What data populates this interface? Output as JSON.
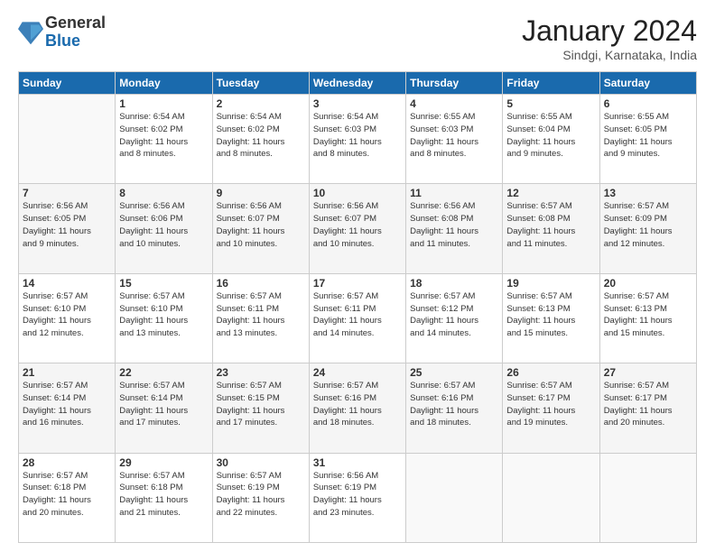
{
  "logo": {
    "general": "General",
    "blue": "Blue"
  },
  "title": "January 2024",
  "subtitle": "Sindgi, Karnataka, India",
  "days_header": [
    "Sunday",
    "Monday",
    "Tuesday",
    "Wednesday",
    "Thursday",
    "Friday",
    "Saturday"
  ],
  "weeks": [
    [
      {
        "day": "",
        "info": ""
      },
      {
        "day": "1",
        "info": "Sunrise: 6:54 AM\nSunset: 6:02 PM\nDaylight: 11 hours\nand 8 minutes."
      },
      {
        "day": "2",
        "info": "Sunrise: 6:54 AM\nSunset: 6:02 PM\nDaylight: 11 hours\nand 8 minutes."
      },
      {
        "day": "3",
        "info": "Sunrise: 6:54 AM\nSunset: 6:03 PM\nDaylight: 11 hours\nand 8 minutes."
      },
      {
        "day": "4",
        "info": "Sunrise: 6:55 AM\nSunset: 6:03 PM\nDaylight: 11 hours\nand 8 minutes."
      },
      {
        "day": "5",
        "info": "Sunrise: 6:55 AM\nSunset: 6:04 PM\nDaylight: 11 hours\nand 9 minutes."
      },
      {
        "day": "6",
        "info": "Sunrise: 6:55 AM\nSunset: 6:05 PM\nDaylight: 11 hours\nand 9 minutes."
      }
    ],
    [
      {
        "day": "7",
        "info": "Sunrise: 6:56 AM\nSunset: 6:05 PM\nDaylight: 11 hours\nand 9 minutes."
      },
      {
        "day": "8",
        "info": "Sunrise: 6:56 AM\nSunset: 6:06 PM\nDaylight: 11 hours\nand 10 minutes."
      },
      {
        "day": "9",
        "info": "Sunrise: 6:56 AM\nSunset: 6:07 PM\nDaylight: 11 hours\nand 10 minutes."
      },
      {
        "day": "10",
        "info": "Sunrise: 6:56 AM\nSunset: 6:07 PM\nDaylight: 11 hours\nand 10 minutes."
      },
      {
        "day": "11",
        "info": "Sunrise: 6:56 AM\nSunset: 6:08 PM\nDaylight: 11 hours\nand 11 minutes."
      },
      {
        "day": "12",
        "info": "Sunrise: 6:57 AM\nSunset: 6:08 PM\nDaylight: 11 hours\nand 11 minutes."
      },
      {
        "day": "13",
        "info": "Sunrise: 6:57 AM\nSunset: 6:09 PM\nDaylight: 11 hours\nand 12 minutes."
      }
    ],
    [
      {
        "day": "14",
        "info": "Sunrise: 6:57 AM\nSunset: 6:10 PM\nDaylight: 11 hours\nand 12 minutes."
      },
      {
        "day": "15",
        "info": "Sunrise: 6:57 AM\nSunset: 6:10 PM\nDaylight: 11 hours\nand 13 minutes."
      },
      {
        "day": "16",
        "info": "Sunrise: 6:57 AM\nSunset: 6:11 PM\nDaylight: 11 hours\nand 13 minutes."
      },
      {
        "day": "17",
        "info": "Sunrise: 6:57 AM\nSunset: 6:11 PM\nDaylight: 11 hours\nand 14 minutes."
      },
      {
        "day": "18",
        "info": "Sunrise: 6:57 AM\nSunset: 6:12 PM\nDaylight: 11 hours\nand 14 minutes."
      },
      {
        "day": "19",
        "info": "Sunrise: 6:57 AM\nSunset: 6:13 PM\nDaylight: 11 hours\nand 15 minutes."
      },
      {
        "day": "20",
        "info": "Sunrise: 6:57 AM\nSunset: 6:13 PM\nDaylight: 11 hours\nand 15 minutes."
      }
    ],
    [
      {
        "day": "21",
        "info": "Sunrise: 6:57 AM\nSunset: 6:14 PM\nDaylight: 11 hours\nand 16 minutes."
      },
      {
        "day": "22",
        "info": "Sunrise: 6:57 AM\nSunset: 6:14 PM\nDaylight: 11 hours\nand 17 minutes."
      },
      {
        "day": "23",
        "info": "Sunrise: 6:57 AM\nSunset: 6:15 PM\nDaylight: 11 hours\nand 17 minutes."
      },
      {
        "day": "24",
        "info": "Sunrise: 6:57 AM\nSunset: 6:16 PM\nDaylight: 11 hours\nand 18 minutes."
      },
      {
        "day": "25",
        "info": "Sunrise: 6:57 AM\nSunset: 6:16 PM\nDaylight: 11 hours\nand 18 minutes."
      },
      {
        "day": "26",
        "info": "Sunrise: 6:57 AM\nSunset: 6:17 PM\nDaylight: 11 hours\nand 19 minutes."
      },
      {
        "day": "27",
        "info": "Sunrise: 6:57 AM\nSunset: 6:17 PM\nDaylight: 11 hours\nand 20 minutes."
      }
    ],
    [
      {
        "day": "28",
        "info": "Sunrise: 6:57 AM\nSunset: 6:18 PM\nDaylight: 11 hours\nand 20 minutes."
      },
      {
        "day": "29",
        "info": "Sunrise: 6:57 AM\nSunset: 6:18 PM\nDaylight: 11 hours\nand 21 minutes."
      },
      {
        "day": "30",
        "info": "Sunrise: 6:57 AM\nSunset: 6:19 PM\nDaylight: 11 hours\nand 22 minutes."
      },
      {
        "day": "31",
        "info": "Sunrise: 6:56 AM\nSunset: 6:19 PM\nDaylight: 11 hours\nand 23 minutes."
      },
      {
        "day": "",
        "info": ""
      },
      {
        "day": "",
        "info": ""
      },
      {
        "day": "",
        "info": ""
      }
    ]
  ]
}
